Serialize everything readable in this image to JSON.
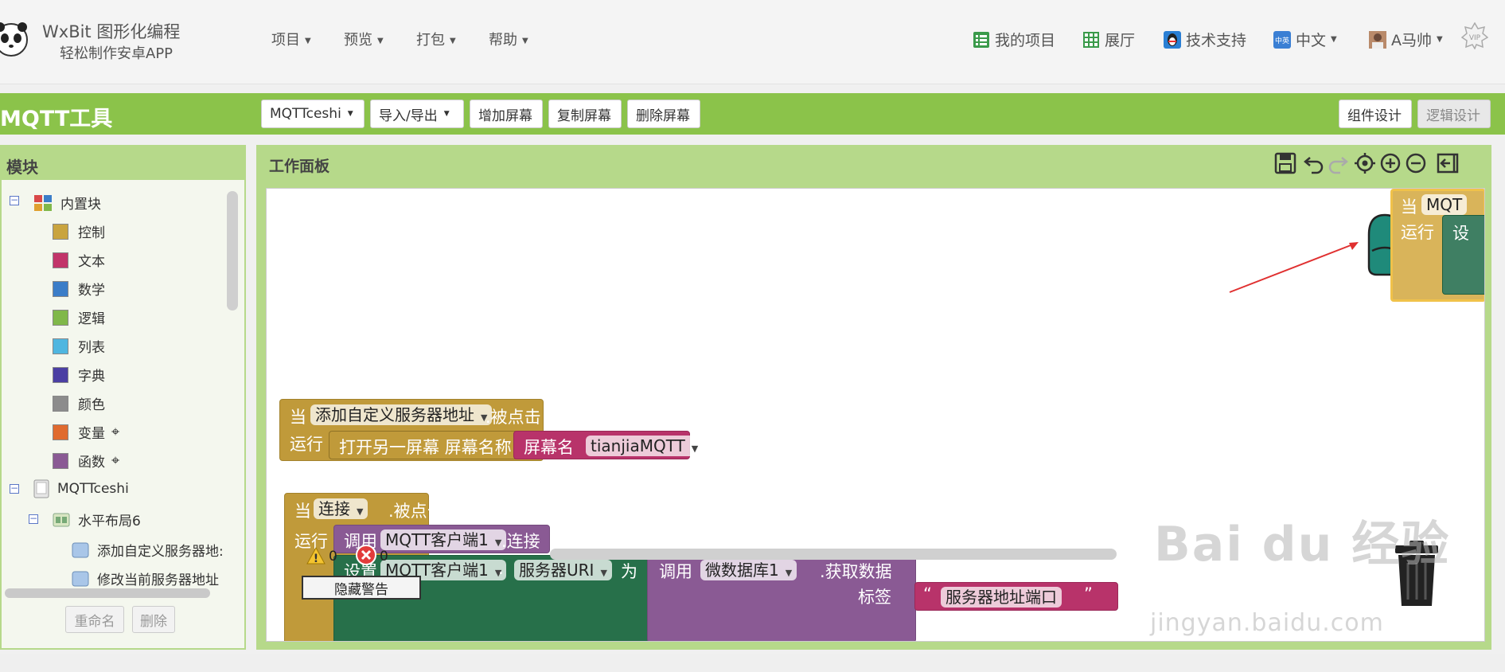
{
  "brand": {
    "name": "WxBit 图形化编程",
    "tagline": "轻松制作安卓APP"
  },
  "menu": [
    "项目",
    "预览",
    "打包",
    "帮助"
  ],
  "right_nav": [
    {
      "label": "我的项目",
      "icon": "list-icon"
    },
    {
      "label": "展厅",
      "icon": "grid-icon"
    },
    {
      "label": "技术支持",
      "icon": "qq-penguin-icon"
    },
    {
      "label": "中文",
      "icon": "language-icon"
    },
    {
      "label": "A马帅",
      "icon": "avatar"
    }
  ],
  "vip_label": "VIP",
  "toolbar": {
    "project_title": "MQTT工具",
    "screen_select": "MQTTceshi",
    "import_export": "导入/导出",
    "add_screen": "增加屏幕",
    "copy_screen": "复制屏幕",
    "delete_screen": "删除屏幕",
    "designer": "组件设计",
    "blocks": "逻辑设计"
  },
  "blocks_panel": {
    "title": "模块",
    "builtin": "内置块",
    "categories": [
      {
        "label": "控制",
        "color": "#c9a43f"
      },
      {
        "label": "文本",
        "color": "#c2356a"
      },
      {
        "label": "数学",
        "color": "#3b7dc8"
      },
      {
        "label": "逻辑",
        "color": "#80b84a"
      },
      {
        "label": "列表",
        "color": "#4fb6e0"
      },
      {
        "label": "字典",
        "color": "#4b3fa3"
      },
      {
        "label": "颜色",
        "color": "#8c8c8c"
      },
      {
        "label": "变量",
        "color": "#e06b2f"
      },
      {
        "label": "函数",
        "color": "#8a5a94"
      }
    ],
    "screen": "MQTTceshi",
    "layout": "水平布局6",
    "components": [
      "添加自定义服务器地:",
      "修改当前服务器地址"
    ],
    "rename_button": "重命名",
    "delete_button": "删除"
  },
  "workspace": {
    "title": "工作面板",
    "warnings": "0",
    "errors": "0",
    "hide_warnings": "隐藏警告"
  },
  "blocks": {
    "b1": {
      "when": "当",
      "component": "添加自定义服务器地址",
      "event": ".被点击",
      "run": "运行",
      "action": "打开另一屏幕  屏幕名称",
      "screen_label": "屏幕名",
      "screen_value": "tianjiaMQTT"
    },
    "b2": {
      "when": "当",
      "component": "连接",
      "event": ".被点击",
      "run": "运行",
      "call": "调用",
      "client": "MQTT客户端1",
      "method": ".连接",
      "set": "设置",
      "client2": "MQTT客户端1",
      "dot": ".",
      "prop": "服务器URI",
      "to": "为",
      "call2": "调用",
      "db": "微数据库1",
      "getdata": ".获取数据",
      "tag_label": "标签",
      "tag_value": "服务器地址端口"
    },
    "b3": {
      "when": "当",
      "component": "MQT",
      "run": "运行",
      "setg": "设"
    }
  },
  "watermark": {
    "big": "Bai du 经验",
    "small": "jingyan.baidu.com"
  }
}
